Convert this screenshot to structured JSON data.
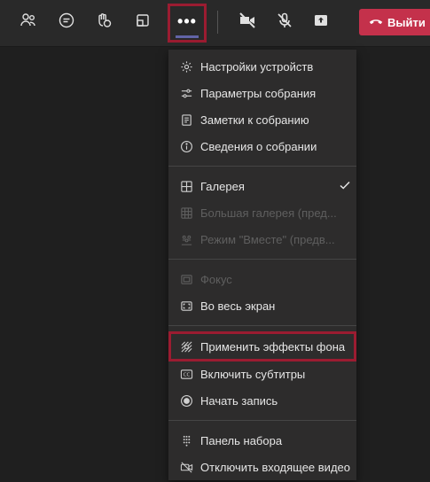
{
  "toolbar": {
    "more_label": "•••",
    "leave_label": "Выйти"
  },
  "menu": {
    "device_settings": "Настройки устройств",
    "meeting_options": "Параметры собрания",
    "meeting_notes": "Заметки к собранию",
    "meeting_info": "Сведения о собрании",
    "gallery": "Галерея",
    "large_gallery": "Большая галерея (пред...",
    "together_mode": "Режим \"Вместе\" (предв...",
    "focus": "Фокус",
    "fullscreen": "Во весь экран",
    "background_effects": "Применить эффекты фона",
    "captions": "Включить субтитры",
    "recording": "Начать запись",
    "dial_pad": "Панель набора",
    "turn_off_video": "Отключить входящее видео"
  },
  "colors": {
    "accent_red": "#c4314b",
    "highlight_border": "#9b1c31",
    "active_underline": "#6264a7"
  }
}
